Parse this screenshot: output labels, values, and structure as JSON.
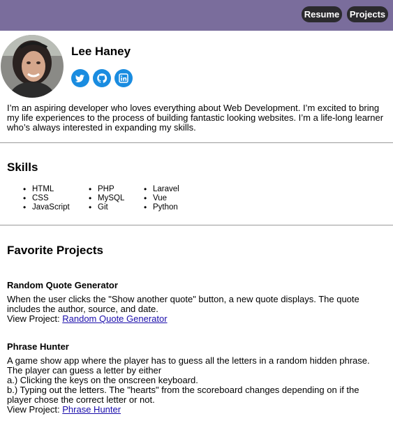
{
  "nav": {
    "resume_label": "Resume",
    "projects_label": "Projects"
  },
  "profile": {
    "name": "Lee Haney",
    "social_icons": [
      "twitter-icon",
      "github-icon",
      "linkedin-icon"
    ],
    "bio": "I’m an aspiring developer who loves everything about Web Development. I’m excited to bring my life experiences to the process of building fantastic looking websites. I’m a life-long learner who’s always interested in expanding my skills."
  },
  "skills": {
    "title": "Skills",
    "columns": [
      [
        "HTML",
        "CSS",
        "JavaScript"
      ],
      [
        "PHP",
        "MySQL",
        "Git"
      ],
      [
        "Laravel",
        "Vue",
        "Python"
      ]
    ]
  },
  "projects": {
    "title": "Favorite Projects",
    "items": [
      {
        "title": "Random Quote Generator",
        "description": "When the user clicks the \"Show another quote\" button, a new quote displays. The quote includes the author, source, and date.",
        "view_prefix": "View Project: ",
        "link_text": "Random Quote Generator"
      },
      {
        "title": "Phrase Hunter",
        "description_lines": [
          "A game show app where the player has to guess all the letters in a random hidden phrase. The player can guess a letter by either",
          "a.) Clicking the keys on the onscreen keyboard.",
          "b.) Typing out the letters. The \"hearts\" from the scoreboard changes depending on if the player chose the correct letter or not."
        ],
        "view_prefix": "View Project: ",
        "link_text": "Phrase Hunter"
      }
    ]
  },
  "colors": {
    "header_bg": "#7a6d9c",
    "nav_button_bg": "#2b2a2e",
    "social_icon_bg": "#1a8ce0",
    "link": "#1a0dab"
  }
}
